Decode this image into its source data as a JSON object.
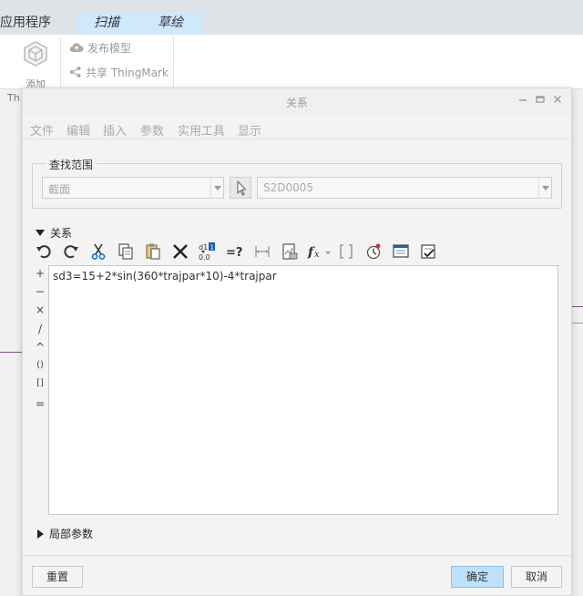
{
  "app": {
    "ribbon_tabs": [
      "应用程序",
      "扫描",
      "草绘"
    ],
    "ribbon_add_label": "添加",
    "ribbon_th_label": "Th",
    "publish_model": "发布模型",
    "share_thingmark": "共享 ThingMark"
  },
  "dialog": {
    "title": "关系",
    "menu": [
      "文件",
      "编辑",
      "插入",
      "参数",
      "实用工具",
      "显示"
    ],
    "search_scope": {
      "legend": "查找范围",
      "scope_value": "截面",
      "object_value": "S2D0005"
    },
    "relations": {
      "header": "关系",
      "toolbar_icons": [
        "undo-icon",
        "redo-icon",
        "cut-icon",
        "copy-icon",
        "paste-icon",
        "delete-icon",
        "sort-icon",
        "evaluate-icon",
        "dimension-icon",
        "verify-icon",
        "function-icon",
        "bracket-icon",
        "parameter-icon",
        "display-icon",
        "check-icon"
      ],
      "operators": [
        "+",
        "−",
        "×",
        "/",
        "^",
        "()",
        "[]",
        "="
      ],
      "text": "sd3=15+2*sin(360*trajpar*10)-4*trajpar"
    },
    "local_params_header": "局部参数",
    "buttons": {
      "reset": "重置",
      "ok": "确定",
      "cancel": "取消"
    }
  },
  "colors": {
    "ribbon_tab_active": "#cfe8fa",
    "primary_button": "#bfe1fb"
  }
}
